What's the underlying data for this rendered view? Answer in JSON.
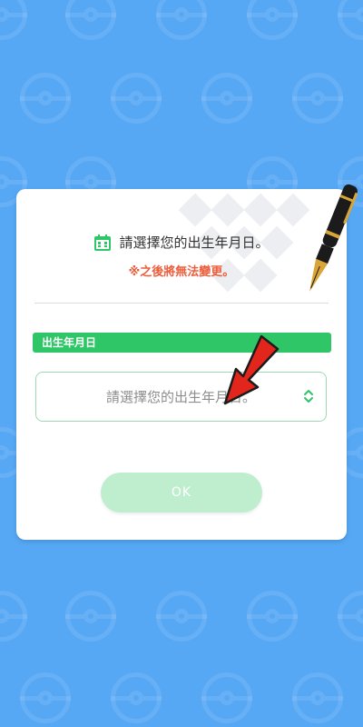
{
  "dialog": {
    "title": "請選擇您的出生年月日。",
    "warning": "※之後將無法變更。",
    "section_label": "出生年月日",
    "select": {
      "placeholder": "請選擇您的出生年月日。"
    },
    "ok_label": "OK"
  },
  "icons": {
    "title_icon": "calendar-icon",
    "select_icon": "chevron-up-down-icon",
    "decor_pen": "fountain-pen-icon",
    "pointer": "red-arrow-icon"
  },
  "colors": {
    "background": "#56a8f5",
    "accent_green": "#2fc667",
    "warning": "#ee5d3b",
    "ok_disabled": "#bfeecf"
  }
}
